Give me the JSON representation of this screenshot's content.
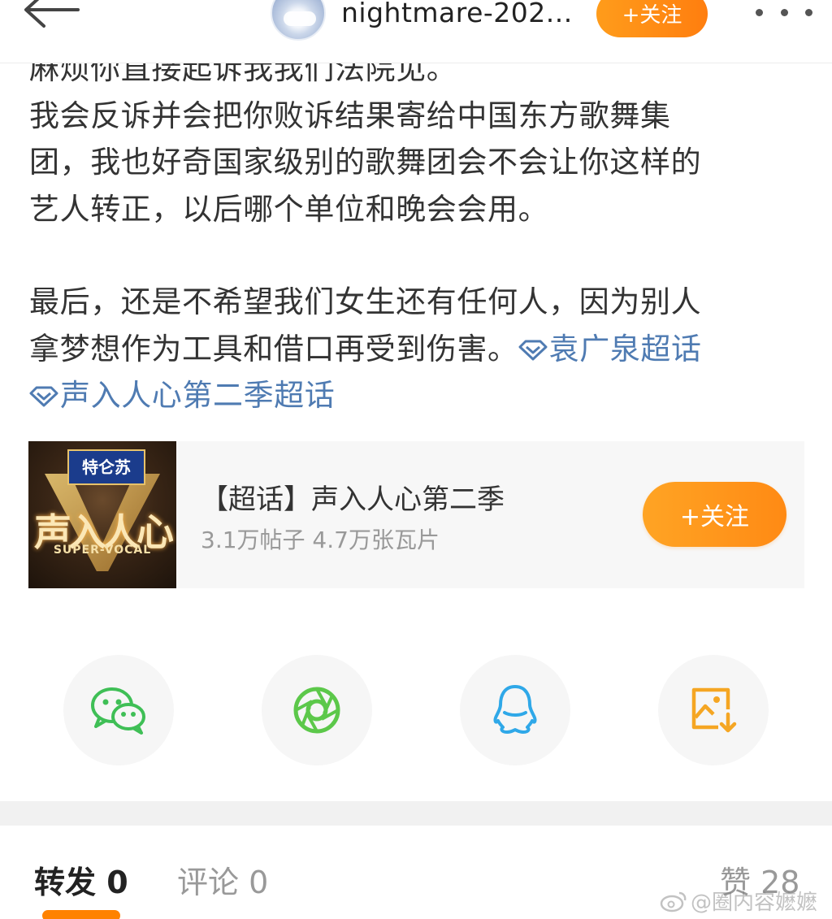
{
  "header": {
    "username": "nightmare-202...",
    "follow_label": "+关注"
  },
  "post": {
    "lines": [
      "麻烦你直接起诉我我们法院见。",
      "我会反诉并会把你败诉结果寄给中国东方歌舞集",
      "团，我也好奇国家级别的歌舞团会不会让你这样的",
      "艺人转正，以后哪个单位和晚会会用。",
      "最后，还是不希望我们女生还有任何人，因为别人",
      "拿梦想作为工具和借口再受到伤害。"
    ],
    "topic_links": [
      "袁广泉超话",
      "声入人心第二季超话"
    ]
  },
  "topic_card": {
    "title": "【超话】声入人心第二季",
    "stats": "3.1万帖子 4.7万张瓦片",
    "follow_label": "+关注",
    "cover_sponsor": "特仑苏",
    "cover_title": "声入人心",
    "cover_subtitle": "SUPER-VOCAL"
  },
  "share": {
    "items": [
      {
        "icon": "wechat-icon",
        "color": "#3fbf56"
      },
      {
        "icon": "moments-icon",
        "color": "#5cc84a"
      },
      {
        "icon": "qq-icon",
        "color": "#2fa8e8"
      },
      {
        "icon": "save-image-icon",
        "color": "#f5a623"
      }
    ]
  },
  "tabs": {
    "repost": "转发 0",
    "comment": "评论 0",
    "like": "赞 28"
  },
  "watermark": "@圈内容嬷嬷",
  "colors": {
    "accent": "#ff8200",
    "link": "#4f7bb2"
  }
}
